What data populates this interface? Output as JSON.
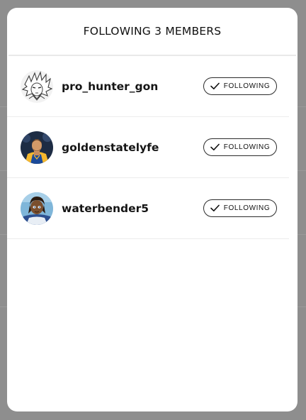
{
  "modal": {
    "title": "FOLLOWING 3 MEMBERS"
  },
  "members": [
    {
      "username": "pro_hunter_gon",
      "button_label": "FOLLOWING",
      "avatar": "anime-character-avatar"
    },
    {
      "username": "goldenstatelyfe",
      "button_label": "FOLLOWING",
      "avatar": "basketball-player-avatar"
    },
    {
      "username": "waterbender5",
      "button_label": "FOLLOWING",
      "avatar": "cartoon-character-avatar"
    }
  ],
  "icons": {
    "follow_check": "check-icon"
  },
  "colors": {
    "backdrop": "#8e8e8e",
    "modal_bg": "#ffffff",
    "button_border": "#2b2b2b",
    "text": "#151515"
  }
}
